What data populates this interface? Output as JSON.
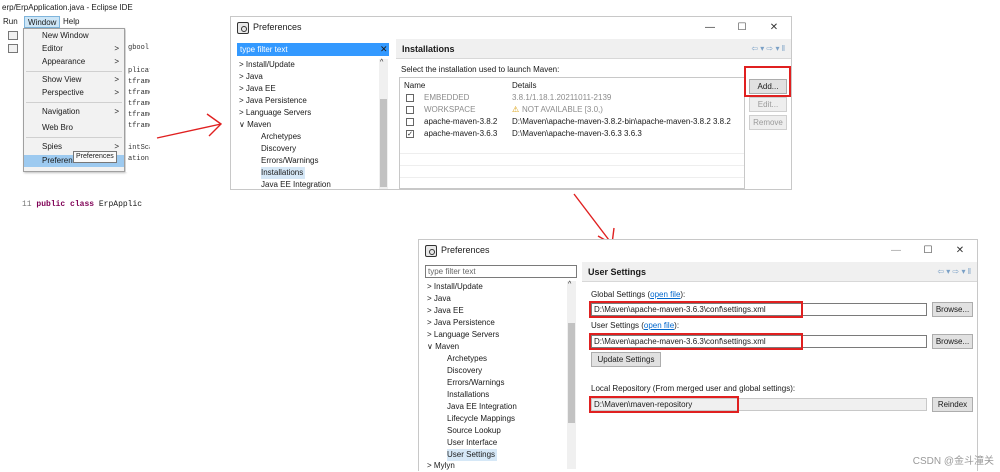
{
  "eclipse": {
    "window_title": "erp/ErpApplication.java - Eclipse IDE",
    "menubar": [
      "Run",
      "Window",
      "Help"
    ],
    "window_menu": [
      {
        "label": "New Window",
        "submenu": false
      },
      {
        "label": "Editor",
        "submenu": true
      },
      {
        "label": "Appearance",
        "submenu": true
      },
      {
        "label": "Show View",
        "submenu": true
      },
      {
        "label": "Perspective",
        "submenu": true
      },
      {
        "label": "Navigation",
        "submenu": true
      },
      {
        "label": "Web Bro",
        "submenu": false
      },
      {
        "label": "Spies",
        "submenu": true
      },
      {
        "label": "Preferences",
        "submenu": false,
        "selected": true
      }
    ],
    "tooltip": "Preferences",
    "code_fragments": [
      "gbool",
      "plicat",
      "tframe",
      "tframe",
      "tframe",
      "tframe",
      "tframe",
      "intSca",
      "ation"
    ],
    "code_line": {
      "number": "11",
      "keyword1": "public",
      "keyword2": "class",
      "name": "ErpApplic"
    }
  },
  "dialog1": {
    "title": "Preferences",
    "controls": {
      "minimize": "—",
      "maximize": "☐",
      "close": "✕"
    },
    "filter_placeholder": "type filter text",
    "filter_clear": "✕",
    "tree": [
      {
        "label": "Install/Update",
        "expander": ">"
      },
      {
        "label": "Java",
        "expander": ">"
      },
      {
        "label": "Java EE",
        "expander": ">"
      },
      {
        "label": "Java Persistence",
        "expander": ">"
      },
      {
        "label": "Language Servers",
        "expander": ">"
      },
      {
        "label": "Maven",
        "expander": "∨"
      },
      {
        "label": "Archetypes",
        "child": true
      },
      {
        "label": "Discovery",
        "child": true
      },
      {
        "label": "Errors/Warnings",
        "child": true
      },
      {
        "label": "Installations",
        "child": true,
        "selected": true
      },
      {
        "label": "Java EE Integration",
        "child": true
      }
    ],
    "page_title": "Installations",
    "nav_arrows": "⇦ ▾ ⇨ ▾ ‖",
    "instruction": "Select the installation used to launch Maven:",
    "columns": [
      "Name",
      "Details"
    ],
    "rows": [
      {
        "name": "EMBEDDED",
        "details": "3.8.1/1.18.1.20211011-2139",
        "checked": false,
        "disabled": true
      },
      {
        "name": "WORKSPACE",
        "details": "NOT AVAILABLE [3.0,)",
        "checked": false,
        "disabled": true,
        "warning_icon": "warning-icon"
      },
      {
        "name": "apache-maven-3.8.2",
        "details": "D:\\Maven\\apache-maven-3.8.2-bin\\apache-maven-3.8.2 3.8.2",
        "checked": false,
        "disabled": false
      },
      {
        "name": "apache-maven-3.6.3",
        "details": "D:\\Maven\\apache-maven-3.6.3 3.6.3",
        "checked": true,
        "disabled": false
      }
    ],
    "buttons": {
      "add": "Add...",
      "edit": "Edit...",
      "remove": "Remove"
    }
  },
  "dialog2": {
    "title": "Preferences",
    "controls": {
      "minimize": "—",
      "maximize": "☐",
      "close": "✕"
    },
    "filter_placeholder": "type filter text",
    "tree": [
      {
        "label": "Install/Update",
        "expander": ">"
      },
      {
        "label": "Java",
        "expander": ">"
      },
      {
        "label": "Java EE",
        "expander": ">"
      },
      {
        "label": "Java Persistence",
        "expander": ">"
      },
      {
        "label": "Language Servers",
        "expander": ">"
      },
      {
        "label": "Maven",
        "expander": "∨"
      },
      {
        "label": "Archetypes",
        "child": true
      },
      {
        "label": "Discovery",
        "child": true
      },
      {
        "label": "Errors/Warnings",
        "child": true
      },
      {
        "label": "Installations",
        "child": true
      },
      {
        "label": "Java EE Integration",
        "child": true
      },
      {
        "label": "Lifecycle Mappings",
        "child": true
      },
      {
        "label": "Source Lookup",
        "child": true
      },
      {
        "label": "User Interface",
        "child": true
      },
      {
        "label": "User Settings",
        "child": true,
        "selected": true
      },
      {
        "label": "Mylyn",
        "expander": ">"
      }
    ],
    "page_title": "User Settings",
    "nav_arrows": "⇦ ▾ ⇨ ▾ ‖",
    "global_settings_label": "Global Settings (",
    "global_settings_link": "open file",
    "global_settings_suffix": "):",
    "global_settings_value": "D:\\Maven\\apache-maven-3.6.3\\conf\\settings.xml",
    "user_settings_label": "User Settings (",
    "user_settings_link": "open file",
    "user_settings_suffix": "):",
    "user_settings_value": "D:\\Maven\\apache-maven-3.6.3\\conf\\settings.xml",
    "update_button": "Update Settings",
    "local_repo_label": "Local Repository (From merged user and global settings):",
    "local_repo_value": "D:\\Maven\\maven-repository",
    "browse_label": "Browse...",
    "reindex_label": "Reindex"
  },
  "watermark": "CSDN @金斗潼关",
  "accent_colors": {
    "annotation_red": "#e02020",
    "selection_blue": "#9dcaf0"
  }
}
